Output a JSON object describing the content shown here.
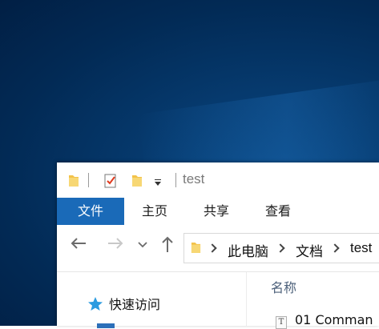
{
  "window": {
    "title": "test"
  },
  "ribbon": {
    "tabs": [
      "文件",
      "主页",
      "共享",
      "查看"
    ]
  },
  "address": {
    "crumbs": [
      "此电脑",
      "文档",
      "test"
    ]
  },
  "nav_pane": {
    "quick_access_label": "快速访问"
  },
  "file_list": {
    "column_name": "名称",
    "rows": [
      "01 Comman"
    ]
  },
  "colors": {
    "accent": "#1a6ab8",
    "desktop": "#022a55",
    "folder": "#f3c24a"
  }
}
